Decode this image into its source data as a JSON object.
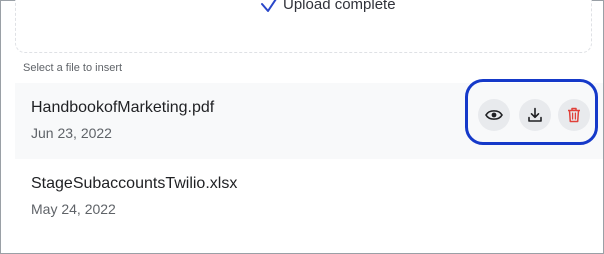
{
  "upload": {
    "status": "Upload complete",
    "progress_percent": 100,
    "check_icon": "check-icon"
  },
  "file_list": {
    "label": "Select a file to insert",
    "files": [
      {
        "name": "HandbookofMarketing.pdf",
        "date": "Jun 23, 2022",
        "actions": [
          "eye-icon",
          "download-icon",
          "trash-icon"
        ]
      },
      {
        "name": "StageSubaccountsTwilio.xlsx",
        "date": "May 24, 2022"
      }
    ]
  },
  "colors": {
    "accent": "#1539c9",
    "delete": "#e0403a",
    "row_highlight": "#f8f9fa"
  }
}
